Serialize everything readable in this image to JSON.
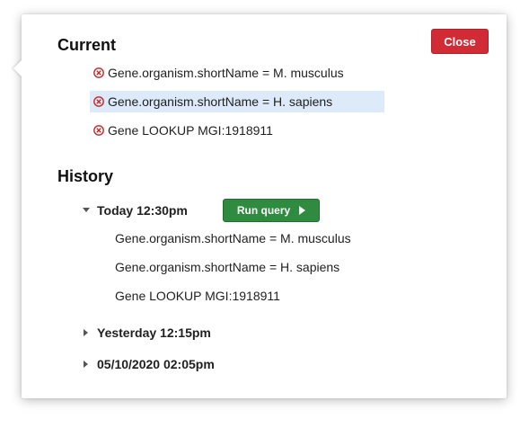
{
  "current": {
    "title": "Current",
    "close_label": "Close",
    "items": [
      {
        "text": "Gene.organism.shortName = M. musculus",
        "selected": false
      },
      {
        "text": "Gene.organism.shortName = H. sapiens",
        "selected": true
      },
      {
        "text": "Gene LOOKUP MGI:1918911",
        "selected": false
      }
    ]
  },
  "history": {
    "title": "History",
    "run_label": "Run query",
    "entries": [
      {
        "timestamp": "Today 12:30pm",
        "expanded": true,
        "queries": [
          "Gene.organism.shortName = M. musculus",
          "Gene.organism.shortName = H. sapiens",
          "Gene LOOKUP MGI:1918911"
        ]
      },
      {
        "timestamp": "Yesterday 12:15pm",
        "expanded": false
      },
      {
        "timestamp": "05/10/2020 02:05pm",
        "expanded": false
      }
    ]
  },
  "colors": {
    "close_button": "#d12b36",
    "run_button": "#2e8b3f",
    "remove_icon": "#c62828",
    "selected_row": "#dceaf9"
  },
  "icons": {
    "remove": "circle-x-icon",
    "expanded": "caret-down-icon",
    "collapsed": "caret-right-icon",
    "run": "play-icon"
  }
}
